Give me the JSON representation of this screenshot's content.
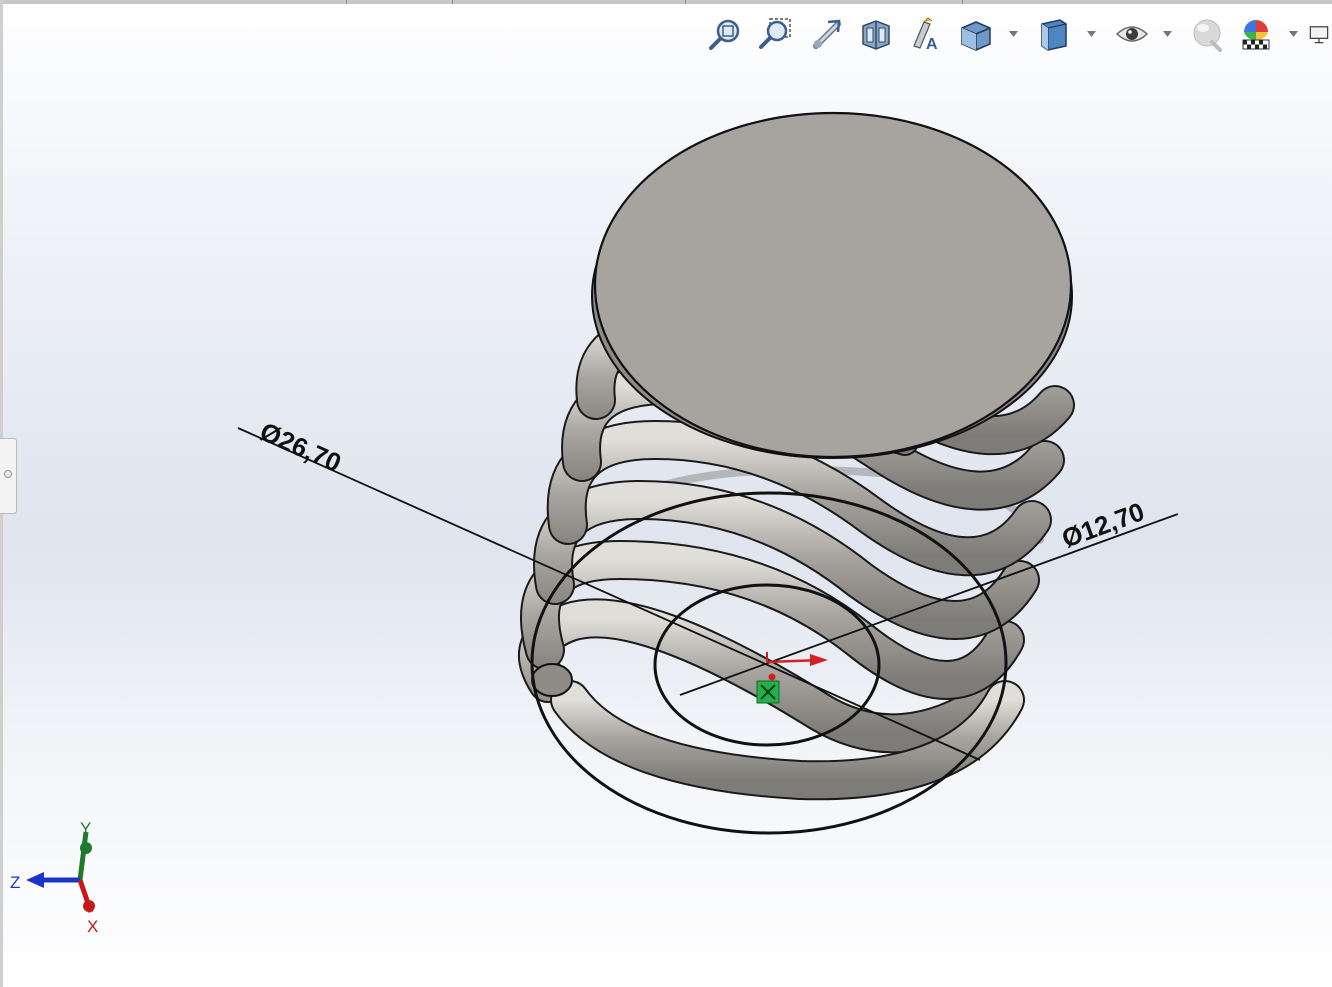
{
  "viewport": {
    "background_top": "#ffffff",
    "background_mid": "#dfe4ee"
  },
  "heads_up_toolbar": [
    {
      "icon": "zoom-to-fit-icon"
    },
    {
      "icon": "zoom-to-area-icon"
    },
    {
      "icon": "previous-view-icon"
    },
    {
      "icon": "section-view-icon"
    },
    {
      "icon": "dynamic-annotation-views-icon"
    },
    {
      "icon": "view-orientation-icon",
      "dropdown": true
    },
    {
      "icon": "display-style-icon",
      "dropdown": true
    },
    {
      "icon": "hide-show-items-icon",
      "dropdown": true
    },
    {
      "icon": "edit-appearance-icon"
    },
    {
      "icon": "apply-scene-icon",
      "dropdown": true
    },
    {
      "icon": "view-settings-icon"
    }
  ],
  "dimensions": {
    "outer_diameter": "Ø26,70",
    "inner_diameter": "Ø12,70"
  },
  "triad": {
    "y_label": "Y",
    "z_label": "Z",
    "x_label": "X",
    "y_color": "#1f7a2e",
    "z_color": "#1c33c8",
    "x_color": "#c41a1a"
  },
  "model": {
    "part": "spring-with-end-disk",
    "steel_color": "#a7a49f",
    "sketch_line_color": "#111111"
  }
}
